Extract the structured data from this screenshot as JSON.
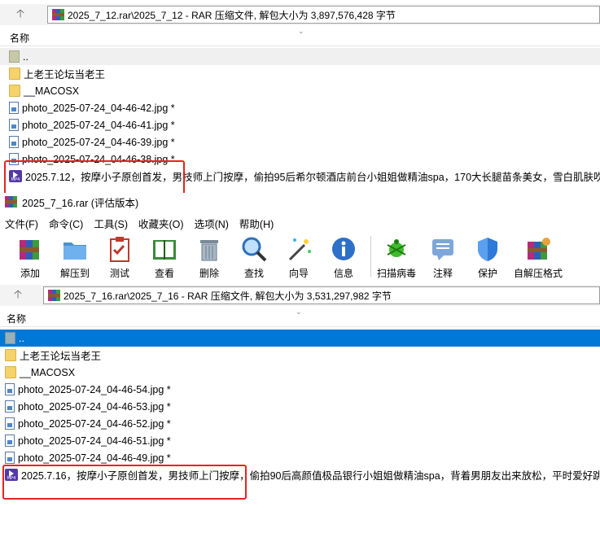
{
  "window_a": {
    "path": "2025_7_12.rar\\2025_7_12 - RAR 压缩文件, 解包大小为 3,897,576,428 字节",
    "column_name": "名称",
    "files": [
      {
        "name": "..",
        "type": "parent"
      },
      {
        "name": "上老王论坛当老王",
        "type": "folder"
      },
      {
        "name": "__MACOSX",
        "type": "folder"
      },
      {
        "name": "photo_2025-07-24_04-46-42.jpg *",
        "type": "jpg"
      },
      {
        "name": "photo_2025-07-24_04-46-41.jpg *",
        "type": "jpg"
      },
      {
        "name": "photo_2025-07-24_04-46-39.jpg *",
        "type": "jpg"
      },
      {
        "name": "photo_2025-07-24_04-46-38.jpg *",
        "type": "jpg"
      },
      {
        "name": "2025.7.12，按摩小子原创首发，男技师上门按摩，偷拍95后希尔顿酒店前台小姐姐做精油spa，170大长腿苗条美女，雪白肌肤吹...",
        "type": "mp4"
      }
    ]
  },
  "window_b": {
    "title": "2025_7_16.rar (评估版本)",
    "menu": [
      "文件(F)",
      "命令(C)",
      "工具(S)",
      "收藏夹(O)",
      "选项(N)",
      "帮助(H)"
    ],
    "toolbar": [
      {
        "label": "添加",
        "icon": "add-archive-icon"
      },
      {
        "label": "解压到",
        "icon": "extract-to-folder-icon"
      },
      {
        "label": "测试",
        "icon": "test-clipboard-icon"
      },
      {
        "label": "查看",
        "icon": "view-book-icon"
      },
      {
        "label": "删除",
        "icon": "delete-trash-icon"
      },
      {
        "label": "查找",
        "icon": "find-magnifier-icon"
      },
      {
        "label": "向导",
        "icon": "wizard-wand-icon"
      },
      {
        "label": "信息",
        "icon": "info-icon"
      },
      {
        "label": "扫描病毒",
        "icon": "virus-scan-icon"
      },
      {
        "label": "注释",
        "icon": "comment-icon"
      },
      {
        "label": "保护",
        "icon": "protect-shield-icon"
      },
      {
        "label": "自解压格式",
        "icon": "sfx-archive-icon"
      }
    ],
    "path": "2025_7_16.rar\\2025_7_16 - RAR 压缩文件, 解包大小为 3,531,297,982 字节",
    "column_name": "名称",
    "files": [
      {
        "name": "..",
        "type": "parent"
      },
      {
        "name": "上老王论坛当老王",
        "type": "folder"
      },
      {
        "name": "__MACOSX",
        "type": "folder"
      },
      {
        "name": "photo_2025-07-24_04-46-54.jpg *",
        "type": "jpg"
      },
      {
        "name": "photo_2025-07-24_04-46-53.jpg *",
        "type": "jpg"
      },
      {
        "name": "photo_2025-07-24_04-46-52.jpg *",
        "type": "jpg"
      },
      {
        "name": "photo_2025-07-24_04-46-51.jpg *",
        "type": "jpg"
      },
      {
        "name": "photo_2025-07-24_04-46-49.jpg *",
        "type": "jpg"
      },
      {
        "name": "2025.7.16，按摩小子原创首发，男技师上门按摩，偷拍90后高颜值极品银行小姐姐做精油spa，背着男朋友出来放松，平时爱好跳...",
        "type": "mp4"
      }
    ]
  }
}
